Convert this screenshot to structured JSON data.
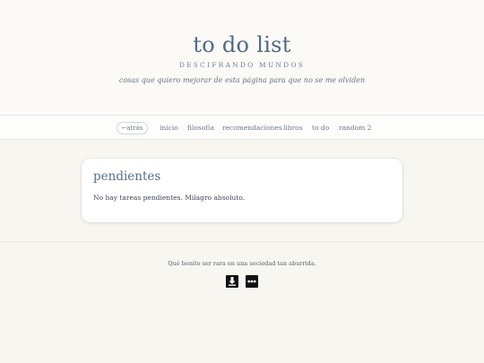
{
  "header": {
    "title": "to do list",
    "subtitle": "DESCIFRANDO MUNDOS",
    "tagline": "cosas que quiero mejorar de esta página para que no se me olviden"
  },
  "nav": {
    "back_label": "←atrás",
    "links": [
      "inicio",
      "filosofía",
      "recomendaciones",
      "libros",
      "to do",
      "random 2"
    ]
  },
  "main": {
    "card_title": "pendientes",
    "card_text": "No hay tareas pendientes. Milagro absoluto."
  },
  "footer": {
    "text": "Qué bonito ser rara en una sociedad tan aburrida.",
    "icons": [
      "download-icon",
      "more-icon"
    ]
  },
  "colors": {
    "background": "#f8f6f1",
    "title": "#4e6b86",
    "link": "#6a7a8c"
  }
}
